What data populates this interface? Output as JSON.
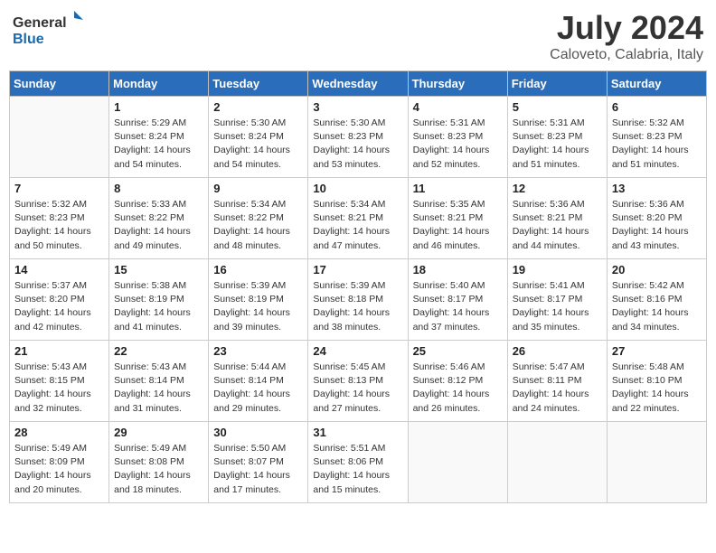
{
  "header": {
    "logo_general": "General",
    "logo_blue": "Blue",
    "month_title": "July 2024",
    "subtitle": "Caloveto, Calabria, Italy"
  },
  "days_of_week": [
    "Sunday",
    "Monday",
    "Tuesday",
    "Wednesday",
    "Thursday",
    "Friday",
    "Saturday"
  ],
  "weeks": [
    [
      {
        "day": "",
        "info": ""
      },
      {
        "day": "1",
        "info": "Sunrise: 5:29 AM\nSunset: 8:24 PM\nDaylight: 14 hours\nand 54 minutes."
      },
      {
        "day": "2",
        "info": "Sunrise: 5:30 AM\nSunset: 8:24 PM\nDaylight: 14 hours\nand 54 minutes."
      },
      {
        "day": "3",
        "info": "Sunrise: 5:30 AM\nSunset: 8:23 PM\nDaylight: 14 hours\nand 53 minutes."
      },
      {
        "day": "4",
        "info": "Sunrise: 5:31 AM\nSunset: 8:23 PM\nDaylight: 14 hours\nand 52 minutes."
      },
      {
        "day": "5",
        "info": "Sunrise: 5:31 AM\nSunset: 8:23 PM\nDaylight: 14 hours\nand 51 minutes."
      },
      {
        "day": "6",
        "info": "Sunrise: 5:32 AM\nSunset: 8:23 PM\nDaylight: 14 hours\nand 51 minutes."
      }
    ],
    [
      {
        "day": "7",
        "info": "Sunrise: 5:32 AM\nSunset: 8:23 PM\nDaylight: 14 hours\nand 50 minutes."
      },
      {
        "day": "8",
        "info": "Sunrise: 5:33 AM\nSunset: 8:22 PM\nDaylight: 14 hours\nand 49 minutes."
      },
      {
        "day": "9",
        "info": "Sunrise: 5:34 AM\nSunset: 8:22 PM\nDaylight: 14 hours\nand 48 minutes."
      },
      {
        "day": "10",
        "info": "Sunrise: 5:34 AM\nSunset: 8:21 PM\nDaylight: 14 hours\nand 47 minutes."
      },
      {
        "day": "11",
        "info": "Sunrise: 5:35 AM\nSunset: 8:21 PM\nDaylight: 14 hours\nand 46 minutes."
      },
      {
        "day": "12",
        "info": "Sunrise: 5:36 AM\nSunset: 8:21 PM\nDaylight: 14 hours\nand 44 minutes."
      },
      {
        "day": "13",
        "info": "Sunrise: 5:36 AM\nSunset: 8:20 PM\nDaylight: 14 hours\nand 43 minutes."
      }
    ],
    [
      {
        "day": "14",
        "info": "Sunrise: 5:37 AM\nSunset: 8:20 PM\nDaylight: 14 hours\nand 42 minutes."
      },
      {
        "day": "15",
        "info": "Sunrise: 5:38 AM\nSunset: 8:19 PM\nDaylight: 14 hours\nand 41 minutes."
      },
      {
        "day": "16",
        "info": "Sunrise: 5:39 AM\nSunset: 8:19 PM\nDaylight: 14 hours\nand 39 minutes."
      },
      {
        "day": "17",
        "info": "Sunrise: 5:39 AM\nSunset: 8:18 PM\nDaylight: 14 hours\nand 38 minutes."
      },
      {
        "day": "18",
        "info": "Sunrise: 5:40 AM\nSunset: 8:17 PM\nDaylight: 14 hours\nand 37 minutes."
      },
      {
        "day": "19",
        "info": "Sunrise: 5:41 AM\nSunset: 8:17 PM\nDaylight: 14 hours\nand 35 minutes."
      },
      {
        "day": "20",
        "info": "Sunrise: 5:42 AM\nSunset: 8:16 PM\nDaylight: 14 hours\nand 34 minutes."
      }
    ],
    [
      {
        "day": "21",
        "info": "Sunrise: 5:43 AM\nSunset: 8:15 PM\nDaylight: 14 hours\nand 32 minutes."
      },
      {
        "day": "22",
        "info": "Sunrise: 5:43 AM\nSunset: 8:14 PM\nDaylight: 14 hours\nand 31 minutes."
      },
      {
        "day": "23",
        "info": "Sunrise: 5:44 AM\nSunset: 8:14 PM\nDaylight: 14 hours\nand 29 minutes."
      },
      {
        "day": "24",
        "info": "Sunrise: 5:45 AM\nSunset: 8:13 PM\nDaylight: 14 hours\nand 27 minutes."
      },
      {
        "day": "25",
        "info": "Sunrise: 5:46 AM\nSunset: 8:12 PM\nDaylight: 14 hours\nand 26 minutes."
      },
      {
        "day": "26",
        "info": "Sunrise: 5:47 AM\nSunset: 8:11 PM\nDaylight: 14 hours\nand 24 minutes."
      },
      {
        "day": "27",
        "info": "Sunrise: 5:48 AM\nSunset: 8:10 PM\nDaylight: 14 hours\nand 22 minutes."
      }
    ],
    [
      {
        "day": "28",
        "info": "Sunrise: 5:49 AM\nSunset: 8:09 PM\nDaylight: 14 hours\nand 20 minutes."
      },
      {
        "day": "29",
        "info": "Sunrise: 5:49 AM\nSunset: 8:08 PM\nDaylight: 14 hours\nand 18 minutes."
      },
      {
        "day": "30",
        "info": "Sunrise: 5:50 AM\nSunset: 8:07 PM\nDaylight: 14 hours\nand 17 minutes."
      },
      {
        "day": "31",
        "info": "Sunrise: 5:51 AM\nSunset: 8:06 PM\nDaylight: 14 hours\nand 15 minutes."
      },
      {
        "day": "",
        "info": ""
      },
      {
        "day": "",
        "info": ""
      },
      {
        "day": "",
        "info": ""
      }
    ]
  ]
}
